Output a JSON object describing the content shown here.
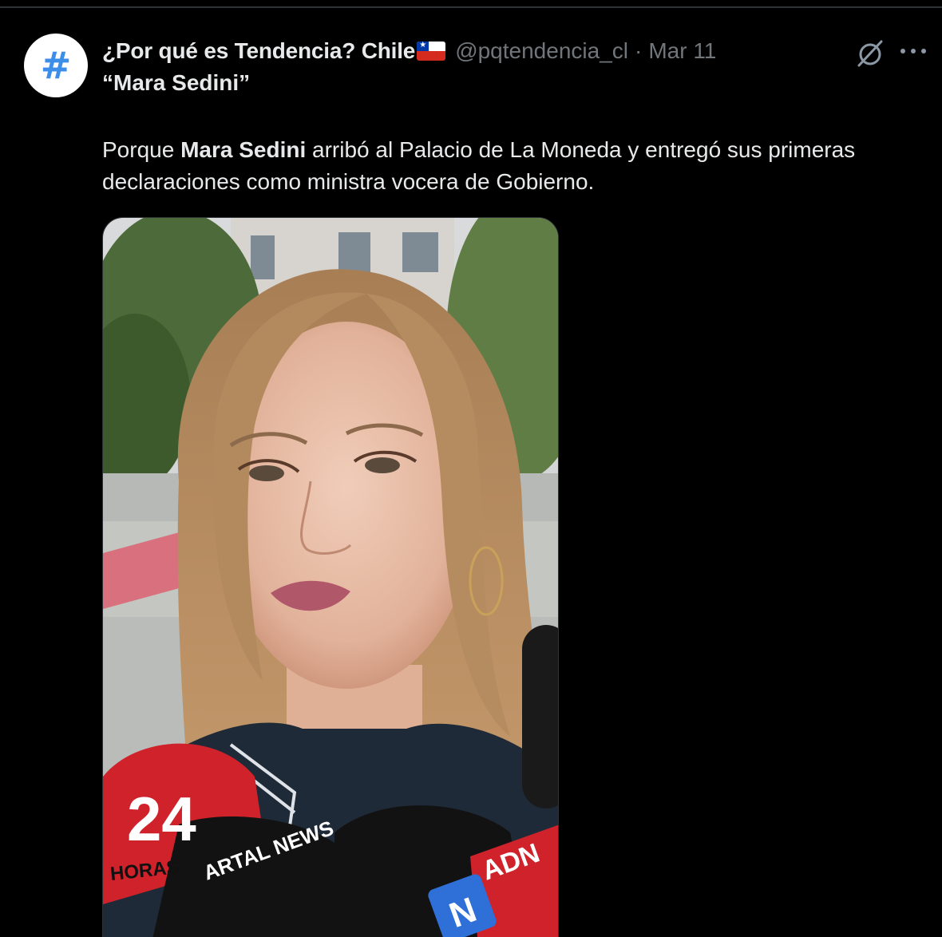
{
  "tweet": {
    "avatar_symbol": "#",
    "display_name": "¿Por qué es Tendencia? Chile",
    "flag": "Chile flag",
    "handle": "@pqtendencia_cl",
    "separator": "·",
    "timestamp": "Mar 11",
    "title": "“Mara Sedini”",
    "body_prefix": "Porque ",
    "body_bold": "Mara Sedini",
    "body_suffix": " arribó al Palacio de La Moneda y entregó sus primeras declaraciones como ministra vocera de Gobierno."
  },
  "media": {
    "mic_labels": {
      "mic1_number": "24",
      "mic1_text": "HORAS",
      "mic2_text": "ARTAL NEWS",
      "mic3_text": "ADN",
      "mic4_text": "N"
    }
  },
  "icons": {
    "grok": "grok-icon",
    "more": "more-icon"
  },
  "colors": {
    "background": "#000000",
    "text_primary": "#e7e9ea",
    "text_secondary": "#71767b",
    "avatar_hash": "#3d8ee8"
  }
}
